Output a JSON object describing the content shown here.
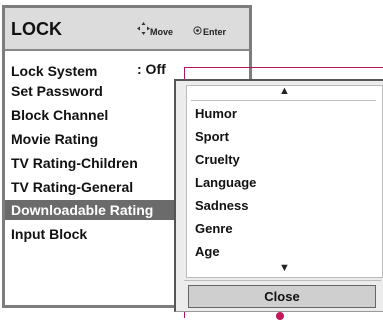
{
  "lock_menu": {
    "title": "LOCK",
    "hints": {
      "move_label": "Move",
      "enter_label": "Enter"
    },
    "items": [
      {
        "label": "Lock System",
        "value": ": Off"
      },
      {
        "label": "Set Password"
      },
      {
        "label": "Block Channel"
      },
      {
        "label": "Movie Rating"
      },
      {
        "label": "TV Rating-Children"
      },
      {
        "label": "TV Rating-General"
      },
      {
        "label": "Downloadable Rating",
        "selected": true
      },
      {
        "label": "Input Block"
      }
    ]
  },
  "popup": {
    "items": [
      "Humor",
      "Sport",
      "Cruelty",
      "Language",
      "Sadness",
      "Genre",
      "Age"
    ],
    "close_label": "Close"
  },
  "colors": {
    "highlight": "#6b6b6b",
    "connector": "#b0175e"
  }
}
